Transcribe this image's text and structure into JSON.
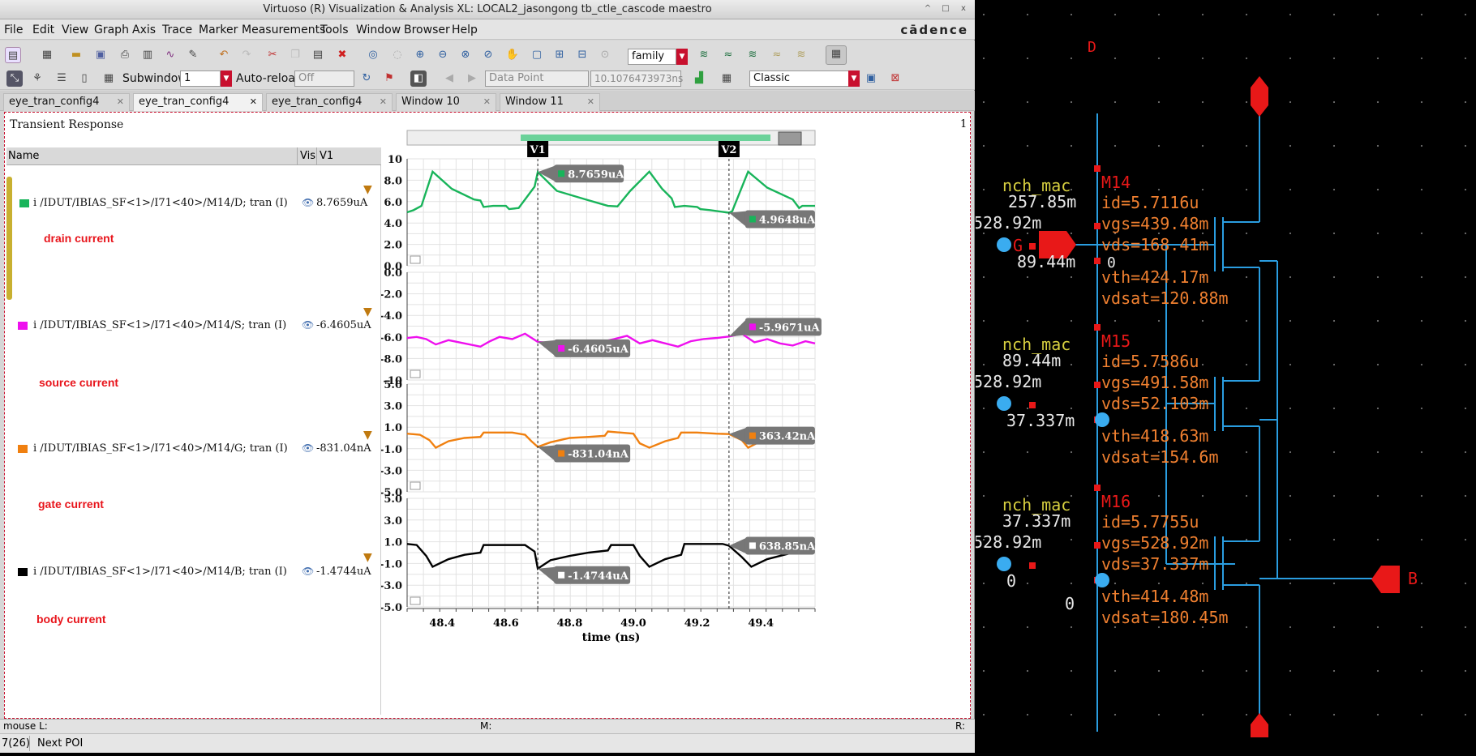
{
  "window": {
    "title": "Virtuoso (R) Visualization & Analysis XL: LOCAL2_jasongong tb_ctle_cascode maestro",
    "brand": "cādence",
    "controls": [
      "^",
      "□",
      "x"
    ]
  },
  "menus": [
    "File",
    "Edit",
    "View",
    "Graph",
    "Axis",
    "Trace",
    "Marker",
    "Measurements",
    "Tools",
    "Window",
    "Browser",
    "Help"
  ],
  "toolbar": {
    "family_value": "family"
  },
  "toolbar2": {
    "subwindow_label": "Subwindow:",
    "subwindow_value": "1",
    "autoreload_label": "Auto-reload",
    "autoreload_value": "Off",
    "datapoint_value": "Data Point",
    "time_value": "10.1076473973ns",
    "style_value": "Classic"
  },
  "tabs": [
    {
      "label": "eye_tran_config4",
      "active": false
    },
    {
      "label": "eye_tran_config4",
      "active": true
    },
    {
      "label": "eye_tran_config4",
      "active": false
    },
    {
      "label": "Window 10",
      "active": false
    },
    {
      "label": "Window 11",
      "active": false
    }
  ],
  "pane": {
    "title": "Transient Response",
    "number": "1"
  },
  "legend": {
    "col_name": "Name",
    "col_vis": "Vis",
    "col_v1": "V1",
    "rows": [
      {
        "name": "i /IDUT/IBIAS_SF<1>/I71<40>/M14/D; tran (I)",
        "value": "8.7659uA",
        "color": "#18b45a",
        "annotation": "drain current"
      },
      {
        "name": "i /IDUT/IBIAS_SF<1>/I71<40>/M14/S; tran (I)",
        "value": "-6.4605uA",
        "color": "#ee10ee",
        "annotation": "source current"
      },
      {
        "name": "i /IDUT/IBIAS_SF<1>/I71<40>/M14/G; tran (I)",
        "value": "-831.04nA",
        "color": "#f08010",
        "annotation": "gate current"
      },
      {
        "name": "i /IDUT/IBIAS_SF<1>/I71<40>/M14/B; tran (I)",
        "value": "-1.4744uA",
        "color": "#000000",
        "annotation": "body current"
      }
    ]
  },
  "chart_data": {
    "type": "line",
    "xlabel": "time (ns)",
    "x_ticks": [
      "48.4",
      "48.6",
      "48.8",
      "49.0",
      "49.2",
      "49.4"
    ],
    "xlim": [
      48.29,
      49.57
    ],
    "markers": [
      {
        "label": "V1",
        "x": 48.7
      },
      {
        "label": "V2",
        "x": 49.3
      }
    ],
    "subplots": [
      {
        "ylabel": "I (uA)",
        "ylim": [
          0,
          10
        ],
        "y_ticks": [
          "10",
          "8.0",
          "6.0",
          "4.0",
          "2.0",
          "0.0"
        ],
        "color": "#18b45a",
        "series_name": "drain current",
        "x": [
          48.29,
          48.31,
          48.335,
          48.37,
          48.43,
          48.5,
          48.52,
          48.53,
          48.56,
          48.6,
          48.61,
          48.64,
          48.69,
          48.7,
          48.76,
          48.85,
          48.92,
          48.95,
          48.99,
          49.05,
          49.09,
          49.12,
          49.13,
          49.16,
          49.2,
          49.21,
          49.24,
          49.29,
          49.3,
          49.31,
          49.36,
          49.42,
          49.5,
          49.52,
          49.53,
          49.57
        ],
        "y": [
          5.0,
          5.2,
          5.6,
          8.8,
          7.2,
          6.2,
          6.1,
          5.5,
          5.6,
          5.6,
          5.3,
          5.4,
          7.4,
          8.7659,
          7.0,
          6.2,
          5.6,
          5.55,
          7.0,
          8.8,
          7.2,
          6.3,
          5.5,
          5.6,
          5.5,
          5.3,
          5.2,
          5.0,
          4.9648,
          5.1,
          8.8,
          7.3,
          6.2,
          5.4,
          5.6,
          5.6
        ],
        "labels": [
          {
            "text": "8.7659uA",
            "x": 48.7,
            "y": 8.7659
          },
          {
            "text": "4.9648uA",
            "x": 49.3,
            "y": 4.9648
          }
        ]
      },
      {
        "ylabel": "I (uA)",
        "ylim": [
          -10,
          0
        ],
        "y_ticks": [
          "0.0",
          "-2.0",
          "-4.0",
          "-6.0",
          "-8.0",
          "-10"
        ],
        "color": "#ee10ee",
        "series_name": "source current",
        "x": [
          48.29,
          48.32,
          48.35,
          48.38,
          48.42,
          48.47,
          48.52,
          48.55,
          48.58,
          48.62,
          48.66,
          48.7,
          48.76,
          48.82,
          48.88,
          48.94,
          48.98,
          49.02,
          49.06,
          49.1,
          49.14,
          49.18,
          49.22,
          49.26,
          49.3,
          49.34,
          49.38,
          49.42,
          49.46,
          49.5,
          49.54,
          49.57
        ],
        "y": [
          -6.1,
          -6.0,
          -6.2,
          -6.7,
          -6.3,
          -6.6,
          -6.9,
          -6.4,
          -6.0,
          -6.2,
          -5.7,
          -6.4605,
          -6.6,
          -6.9,
          -6.6,
          -6.2,
          -5.9,
          -6.6,
          -6.3,
          -6.6,
          -6.9,
          -6.4,
          -6.2,
          -6.1,
          -5.9671,
          -5.7,
          -6.5,
          -6.2,
          -6.6,
          -6.8,
          -6.4,
          -6.6
        ],
        "labels": [
          {
            "text": "-6.4605uA",
            "x": 48.7,
            "y": -6.4605
          },
          {
            "text": "-5.9671uA",
            "x": 49.3,
            "y": -5.9671
          }
        ]
      },
      {
        "ylabel": "I (uA)",
        "ylim": [
          -5,
          5
        ],
        "y_ticks": [
          "5.0",
          "3.0",
          "1.0",
          "-1.0",
          "-3.0",
          "-5.0"
        ],
        "color": "#f08010",
        "series_name": "gate current",
        "x": [
          48.29,
          48.33,
          48.36,
          48.38,
          48.42,
          48.47,
          48.52,
          48.53,
          48.57,
          48.62,
          48.66,
          48.68,
          48.7,
          48.74,
          48.8,
          48.86,
          48.91,
          48.92,
          48.96,
          49.0,
          49.02,
          49.05,
          49.1,
          49.14,
          49.15,
          49.2,
          49.26,
          49.3,
          49.34,
          49.36,
          49.4,
          49.46,
          49.52,
          49.53,
          49.57
        ],
        "y": [
          0.4,
          0.3,
          -0.2,
          -0.9,
          -0.3,
          0.0,
          0.1,
          0.5,
          0.5,
          0.5,
          0.3,
          -0.3,
          -0.831,
          -0.4,
          0.0,
          0.1,
          0.2,
          0.6,
          0.5,
          0.4,
          -0.5,
          -0.9,
          -0.3,
          0.0,
          0.5,
          0.5,
          0.4,
          0.363,
          -0.2,
          -0.9,
          -0.3,
          0.1,
          0.2,
          0.6,
          0.5
        ],
        "labels": [
          {
            "text": "-831.04nA",
            "x": 48.7,
            "y": -0.831
          },
          {
            "text": "363.42nA",
            "x": 49.3,
            "y": 0.363
          }
        ]
      },
      {
        "ylabel": "I (uA)",
        "ylim": [
          -5,
          5
        ],
        "y_ticks": [
          "5.0",
          "3.0",
          "1.0",
          "-1.0",
          "-3.0",
          "-5.0"
        ],
        "color": "#000000",
        "series_name": "body current",
        "x": [
          48.29,
          48.32,
          48.35,
          48.37,
          48.42,
          48.47,
          48.52,
          48.53,
          48.6,
          48.66,
          48.69,
          48.7,
          48.74,
          48.8,
          48.86,
          48.92,
          48.93,
          49.0,
          49.02,
          49.05,
          49.1,
          49.15,
          49.16,
          49.22,
          49.28,
          49.3,
          49.34,
          49.37,
          49.42,
          49.5,
          49.53,
          49.57
        ],
        "y": [
          0.8,
          0.7,
          -0.3,
          -1.3,
          -0.6,
          -0.2,
          0.0,
          0.7,
          0.7,
          0.7,
          0.1,
          -1.4744,
          -0.7,
          -0.3,
          0.0,
          0.2,
          0.7,
          0.7,
          -0.3,
          -1.3,
          -0.6,
          -0.2,
          0.8,
          0.8,
          0.8,
          0.6389,
          -0.4,
          -1.3,
          -0.6,
          0.0,
          0.7,
          0.8
        ],
        "labels": [
          {
            "text": "-1.4744uA",
            "x": 48.7,
            "y": -1.4744
          },
          {
            "text": "638.85nA",
            "x": 49.3,
            "y": 0.6389
          }
        ]
      }
    ]
  },
  "status": {
    "mouse_l": "mouse L:",
    "mouse_m": "M:",
    "mouse_r": "R:",
    "poi_count": "7(26)",
    "poi_label": "Next POI"
  },
  "schematic": {
    "pins": {
      "gate": "G",
      "drain": "D",
      "bulk": "B"
    },
    "transistors": [
      {
        "model": "nch_mac",
        "name": "M14",
        "vb": "257.85m",
        "vg": "528.92m",
        "vs": "89.44m",
        "params": [
          "id=5.7116u",
          "vgs=439.48m",
          "vds=168.41m",
          "vth=424.17m",
          "vdsat=120.88m"
        ],
        "side_label": "0"
      },
      {
        "model": "nch_mac",
        "name": "M15",
        "vb": "89.44m",
        "vg": "528.92m",
        "vs": "37.337m",
        "params": [
          "id=5.7586u",
          "vgs=491.58m",
          "vds=52.103m",
          "vth=418.63m",
          "vdsat=154.6m"
        ]
      },
      {
        "model": "nch_mac",
        "name": "M16",
        "vb": "37.337m",
        "vg": "528.92m",
        "vs": "0",
        "params": [
          "id=5.7755u",
          "vgs=528.92m",
          "vds=37.337m",
          "vth=414.48m",
          "vdsat=180.45m"
        ]
      }
    ]
  }
}
